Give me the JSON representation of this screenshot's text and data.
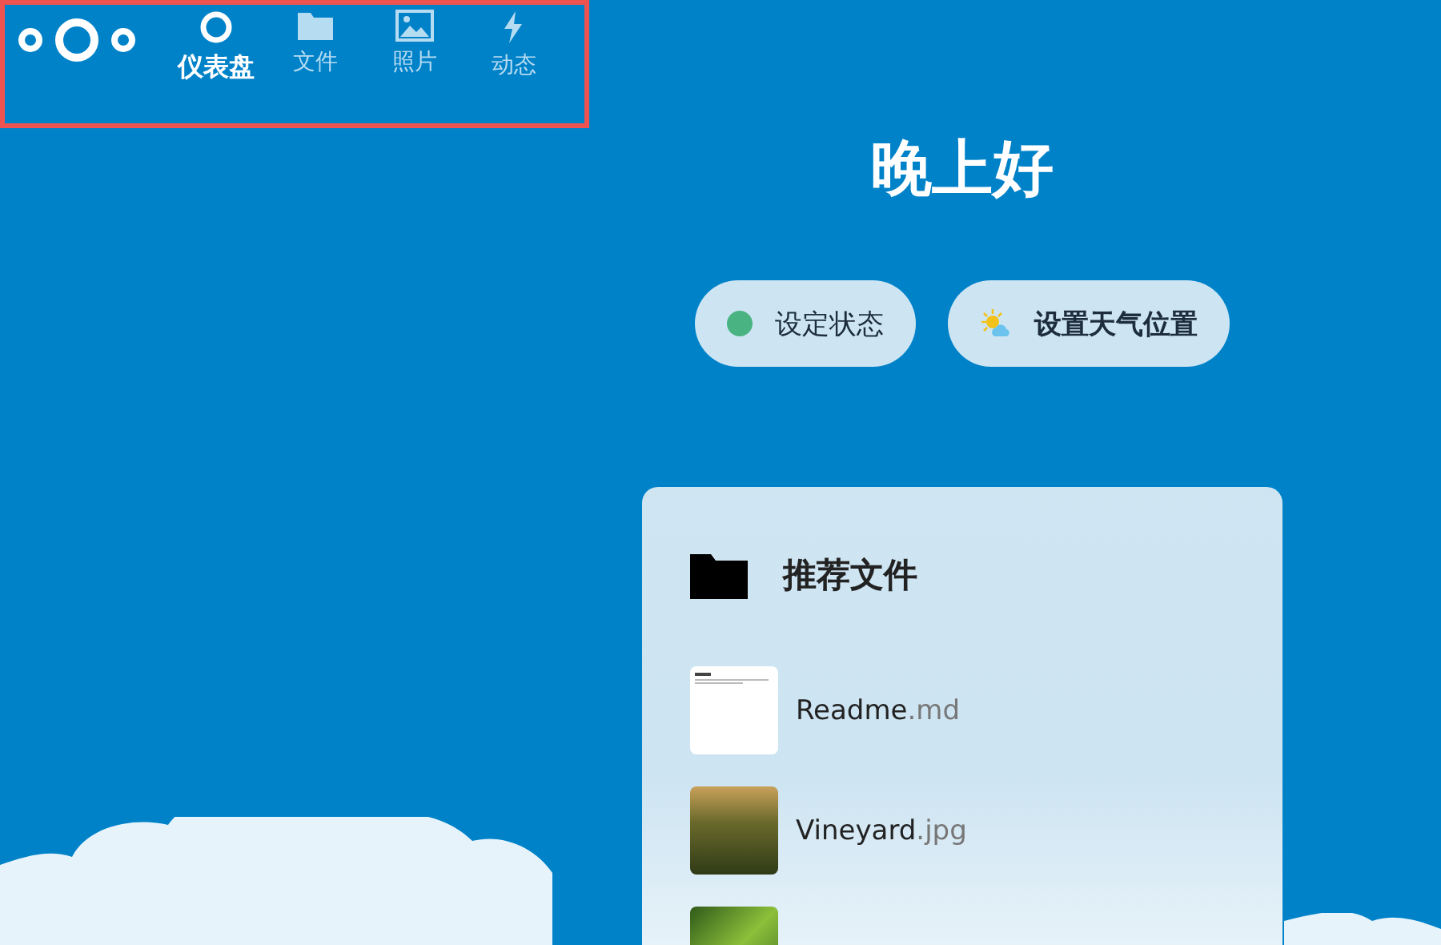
{
  "nav": [
    {
      "kind": "dashboard",
      "label": "仪表盘",
      "selected": true
    },
    {
      "kind": "files",
      "label": "文件",
      "selected": false
    },
    {
      "kind": "photos",
      "label": "照片",
      "selected": false
    },
    {
      "kind": "activity",
      "label": "动态",
      "selected": false
    }
  ],
  "greeting": "晚上好",
  "actions": [
    {
      "kind": "status",
      "label": "设定状态",
      "color": "#49b382"
    },
    {
      "kind": "weather",
      "label": "设置天气位置"
    }
  ],
  "widget": {
    "title": "推荐文件",
    "files": [
      {
        "kind": "document",
        "name": "Readme",
        "ext": ".md"
      },
      {
        "kind": "photo",
        "name": "Vineyard",
        "ext": ".jpg"
      },
      {
        "kind": "photo-leaf"
      }
    ]
  }
}
